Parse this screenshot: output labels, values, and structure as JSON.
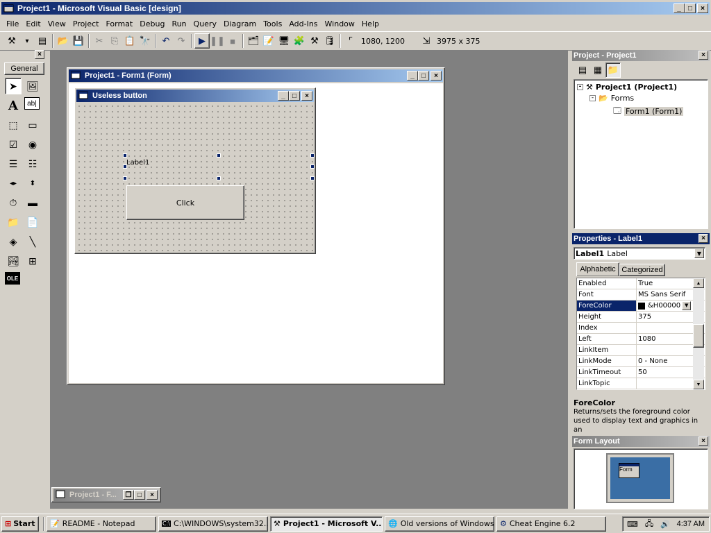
{
  "app": {
    "title": "Project1 - Microsoft Visual Basic [design]"
  },
  "menu": [
    "File",
    "Edit",
    "View",
    "Project",
    "Format",
    "Debug",
    "Run",
    "Query",
    "Diagram",
    "Tools",
    "Add-Ins",
    "Window",
    "Help"
  ],
  "toolbar": {
    "position": "1080, 1200",
    "size": "3975 x 375"
  },
  "toolbox": {
    "tab": "General"
  },
  "form_window": {
    "title": "Project1 - Form1 (Form)"
  },
  "form": {
    "caption": "Useless button",
    "label": "Label1",
    "button": "Click"
  },
  "minimized_window": {
    "title": "Project1 - F..."
  },
  "project_panel": {
    "title": "Project - Project1",
    "root": "Project1 (Project1)",
    "folder": "Forms",
    "item": "Form1 (Form1)"
  },
  "properties_panel": {
    "title": "Properties - Label1",
    "object_name": "Label1",
    "object_type": "Label",
    "tab_alpha": "Alphabetic",
    "tab_cat": "Categorized",
    "rows": [
      {
        "name": "Enabled",
        "value": "True"
      },
      {
        "name": "Font",
        "value": "MS Sans Serif"
      },
      {
        "name": "ForeColor",
        "value": "&H00000"
      },
      {
        "name": "Height",
        "value": "375"
      },
      {
        "name": "Index",
        "value": ""
      },
      {
        "name": "Left",
        "value": "1080"
      },
      {
        "name": "LinkItem",
        "value": ""
      },
      {
        "name": "LinkMode",
        "value": "0 - None"
      },
      {
        "name": "LinkTimeout",
        "value": "50"
      },
      {
        "name": "LinkTopic",
        "value": ""
      }
    ],
    "desc_title": "ForeColor",
    "desc_text": "Returns/sets the foreground color used to display text and graphics in an"
  },
  "layout_panel": {
    "title": "Form Layout",
    "thumb": "Form"
  },
  "taskbar": {
    "start": "Start",
    "tasks": [
      "README - Notepad",
      "C:\\WINDOWS\\system32...",
      "Project1 - Microsoft V...",
      "Old versions of Windows...",
      "Cheat Engine 6.2"
    ],
    "clock": "4:37 AM"
  },
  "colors": {
    "active_title": "#0a246a",
    "face": "#d4d0c8",
    "mdi": "#808080"
  }
}
